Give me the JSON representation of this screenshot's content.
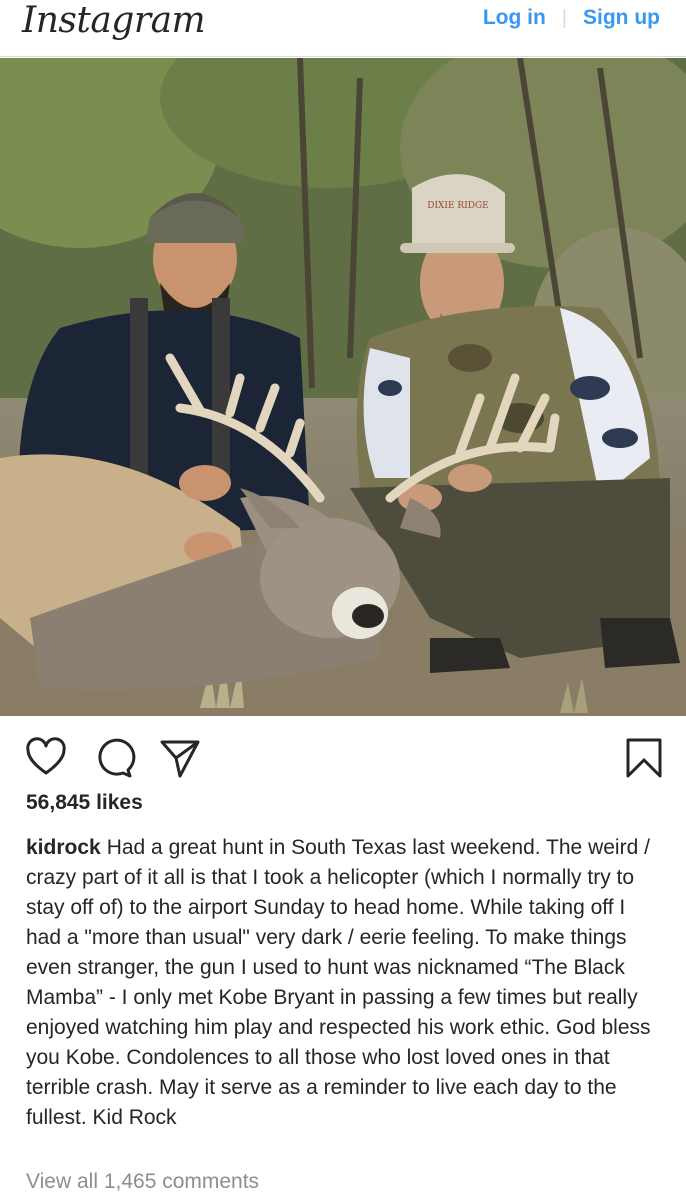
{
  "header": {
    "logo_text": "Instagram",
    "login_label": "Log in",
    "separator": "|",
    "signup_label": "Sign up"
  },
  "post": {
    "photo_icon": "post-photo",
    "cap_text": "DIXIE RIDGE",
    "likes": "56,845 likes",
    "username": "kidrock",
    "caption": "Had a great hunt in South Texas last weekend. The weird / crazy part of it all is that I took a helicopter (which I normally try to stay off of) to the airport Sunday to head home. While taking off I had a \"more than usual\" very dark / eerie feeling. To make things even stranger, the gun I used to hunt was nicknamed “The Black Mamba” - I only met Kobe Bryant in passing a few times but really enjoyed watching him play and respected his work ethic. God bless you Kobe. Condolences to all those who lost loved ones in that terrible crash. May it serve as a reminder to live each day to the fullest. Kid Rock",
    "view_comments": "View all 1,465 comments"
  },
  "icons": {
    "like": "heart-icon",
    "comment": "comment-bubble-icon",
    "share": "send-icon",
    "save": "bookmark-icon"
  },
  "colors": {
    "link_blue": "#3897f0",
    "text": "#262626",
    "muted": "#8e8e8e",
    "border": "#dbdbdb"
  }
}
